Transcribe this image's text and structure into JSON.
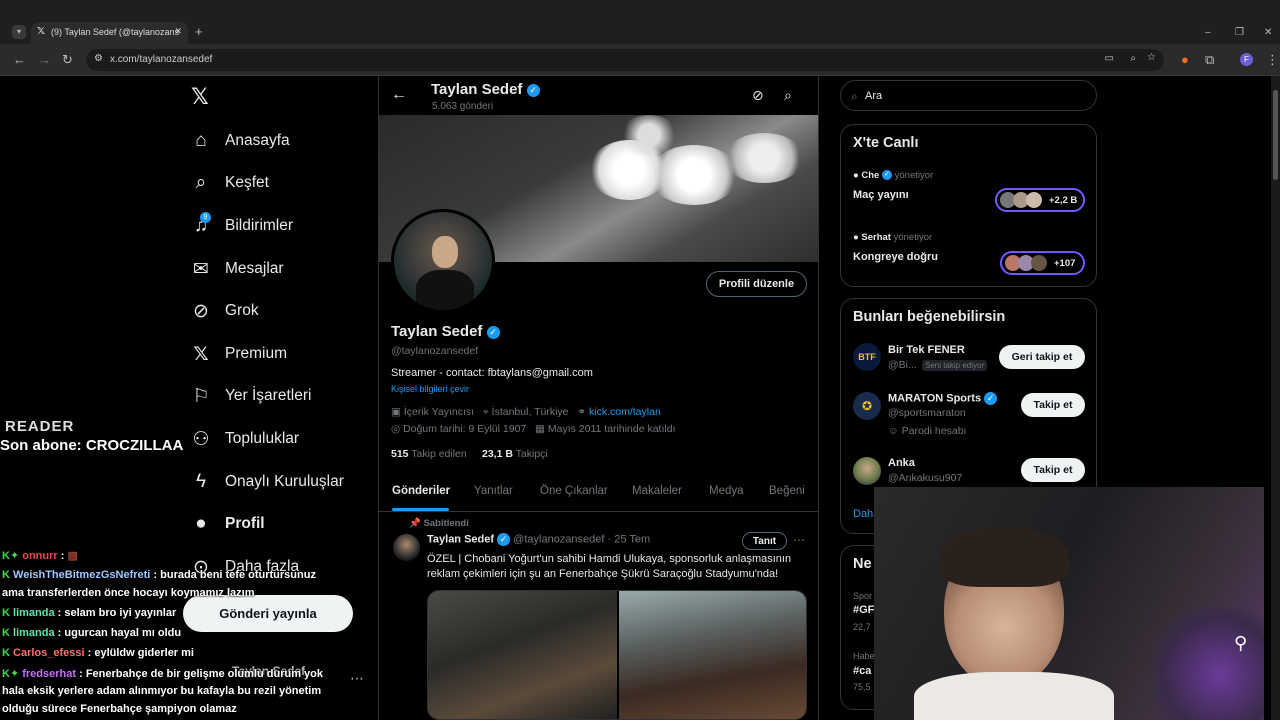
{
  "browser": {
    "tab_title": "(9) Taylan Sedef (@taylanozans",
    "url": "x.com/taylanozansedef"
  },
  "nav": {
    "items": [
      {
        "label": "Anasayfa",
        "icon": "home-icon"
      },
      {
        "label": "Keşfet",
        "icon": "search-icon"
      },
      {
        "label": "Bildirimler",
        "icon": "bell-icon"
      },
      {
        "label": "Mesajlar",
        "icon": "mail-icon"
      },
      {
        "label": "Grok",
        "icon": "grok-icon"
      },
      {
        "label": "Premium",
        "icon": "x-logo-icon"
      },
      {
        "label": "Yer İşaretleri",
        "icon": "bookmark-icon"
      },
      {
        "label": "Topluluklar",
        "icon": "people-icon"
      },
      {
        "label": "Onaylı Kuruluşlar",
        "icon": "lightning-icon"
      },
      {
        "label": "Profil",
        "icon": "person-icon"
      },
      {
        "label": "Daha fazla",
        "icon": "more-circle-icon"
      }
    ],
    "notification_count": "9",
    "post_button": "Gönderi yayınla",
    "account_name": "Taylan Sedef"
  },
  "profile": {
    "header_name": "Taylan Sedef",
    "post_count": "5.063 gönderi",
    "name": "Taylan Sedef",
    "handle": "@taylanozansedef",
    "edit_button": "Profili düzenle",
    "bio": "Streamer - contact: fbtaylans@gmail.com",
    "translate": "Kişisel bilgileri çevir",
    "category": "İçerik Yayıncısı",
    "location": "İstanbul, Türkiye",
    "website": "kick.com/taylan",
    "birthday": "Doğum tarihi: 9 Eylül 1907",
    "joined": "Mayıs 2011 tarihinde katıldı",
    "following_count": "515",
    "following_label": "Takip edilen",
    "followers_count": "23,1 B",
    "followers_label": "Takipçi",
    "tabs": [
      "Gönderiler",
      "Yanıtlar",
      "Öne Çıkanlar",
      "Makaleler",
      "Medya",
      "Beğeni"
    ]
  },
  "pinned_post": {
    "pinned_label": "Sabitlendi",
    "author": "Taylan Sedef",
    "handle_date": "@taylanozansedef · 25 Tem",
    "promote_button": "Tanıt",
    "text": "ÖZEL | Chobani Yoğurt'un sahibi Hamdi Ulukaya, sponsorluk anlaşmasının reklam çekimleri için şu an Fenerbahçe Şükrü Saraçoğlu Stadyumu'nda!"
  },
  "right": {
    "search_placeholder": "Ara",
    "live_title": "X'te Canlı",
    "live": [
      {
        "host": "Che",
        "suffix": "yönetiyor",
        "title": "Maç yayını",
        "count": "+2,2 B"
      },
      {
        "host": "Serhat",
        "suffix": "yönetiyor",
        "title": "Kongreye doğru",
        "count": "+107"
      }
    ],
    "suggest_title": "Bunları beğenebilirsin",
    "suggestions": [
      {
        "name": "Bir Tek FENER",
        "handle": "@Bi...",
        "badge": "Seni takip ediyor",
        "button": "Geri takip et"
      },
      {
        "name": "MARATON Sports",
        "handle": "@sportsmaraton",
        "note": "Parodi hesabı",
        "button": "Takip et"
      },
      {
        "name": "Anka",
        "handle": "@Ankakusu907",
        "button": "Takip et"
      }
    ],
    "show_more": "Daha",
    "news_title": "Ne",
    "trends": [
      {
        "cat": "Spor",
        "tag": "#GF",
        "count": "22,7"
      },
      {
        "cat": "Habe",
        "tag": "#ca",
        "count": "75,5"
      }
    ]
  },
  "overlay": {
    "reader_logo": "READER",
    "last_sub": "Son abone: CROCZILLAA",
    "chat": [
      {
        "user": "onnurr",
        "msg": ":",
        "color": "#e0494c"
      },
      {
        "user": "WeishTheBitmezGsNefreti",
        "msg": ": burada beni tefe oturtursunuz",
        "color": "#9ec6ff"
      },
      {
        "user": "",
        "msg": "ama transferlerden önce hocayı koymamız lazım",
        "color": "#fff"
      },
      {
        "user": "limanda",
        "msg": ": selam bro iyi yayınlar",
        "color": "#5ce6a8"
      },
      {
        "user": "limanda",
        "msg": ": ugurcan hayal mı oldu",
        "color": "#5ce6a8"
      },
      {
        "user": "Carlos_efessi",
        "msg": ": eylüldw giderler mi",
        "color": "#ff6e6e"
      },
      {
        "user": "fredserhat",
        "msg": ": Fenerbahçe de bir gelişme olumlu durum yok",
        "color": "#c86cff"
      },
      {
        "user": "",
        "msg": "hala eksik yerlere adam alınmıyor bu kafayla bu rezil yönetim",
        "color": "#fff"
      },
      {
        "user": "",
        "msg": "olduğu sürece Fenerbahçe şampiyon olamaz",
        "color": "#fff"
      }
    ]
  }
}
